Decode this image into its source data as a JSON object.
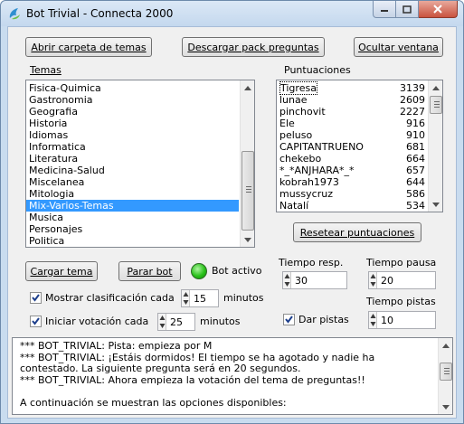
{
  "window": {
    "title": "Bot Trivial - Connecta 2000"
  },
  "top_buttons": {
    "open_folder": "Abrir carpeta de temas",
    "download_pack": "Descargar pack preguntas",
    "hide_window": "Ocultar ventana"
  },
  "topics": {
    "label": "Temas",
    "items": [
      "Fisica-Quimica",
      "Gastronomia",
      "Geografia",
      "Historia",
      "Idiomas",
      "Informatica",
      "Literatura",
      "Medicina-Salud",
      "Miscelanea",
      "Mitologia",
      "Mix-Varios-Temas",
      "Musica",
      "Personajes",
      "Politica"
    ],
    "selected": "Mix-Varios-Temas"
  },
  "scores": {
    "label": "Puntuaciones",
    "rows": [
      {
        "name": "Tigresa",
        "points": "3139"
      },
      {
        "name": "lunae",
        "points": "2609"
      },
      {
        "name": "pinchovit",
        "points": "2227"
      },
      {
        "name": "Ele",
        "points": "916"
      },
      {
        "name": "peluso",
        "points": "910"
      },
      {
        "name": "CAPITANTRUENO",
        "points": "681"
      },
      {
        "name": "chekebo",
        "points": "664"
      },
      {
        "name": "*_*ANJHARA*_*",
        "points": "657"
      },
      {
        "name": "kobrah1973",
        "points": "644"
      },
      {
        "name": "mussycruz",
        "points": "586"
      },
      {
        "name": "Natalí",
        "points": "534"
      }
    ],
    "reset_button": "Resetear puntuaciones"
  },
  "controls": {
    "load_topic": "Cargar tema",
    "stop_bot": "Parar bot",
    "bot_status": "Bot activo",
    "show_ranking_label": "Mostrar clasificación cada",
    "show_ranking_value": "15",
    "show_ranking_unit": "minutos",
    "start_vote_label": "Iniciar votación cada",
    "start_vote_value": "25",
    "start_vote_unit": "minutos",
    "response_time_label": "Tiempo resp.",
    "response_time_value": "30",
    "pause_time_label": "Tiempo pausa",
    "pause_time_value": "20",
    "hint_time_label": "Tiempo pistas",
    "hint_time_value": "10",
    "give_hints_label": "Dar pistas"
  },
  "log": {
    "lines": [
      " *** BOT_TRIVIAL:     Pista: empieza por M",
      " *** BOT_TRIVIAL:    ¡Estáis dormidos! El tiempo se ha agotado y nadie ha",
      "contestado. La siguiente pregunta será en 20 segundos.",
      " *** BOT_TRIVIAL:    Ahora empieza la votación del tema de preguntas!!",
      "",
      "    A continuación se muestran las opciones disponibles:"
    ]
  },
  "colors": {
    "selection": "#3399ff",
    "window_frame": "#c9dcef",
    "led": "#29c11a"
  }
}
